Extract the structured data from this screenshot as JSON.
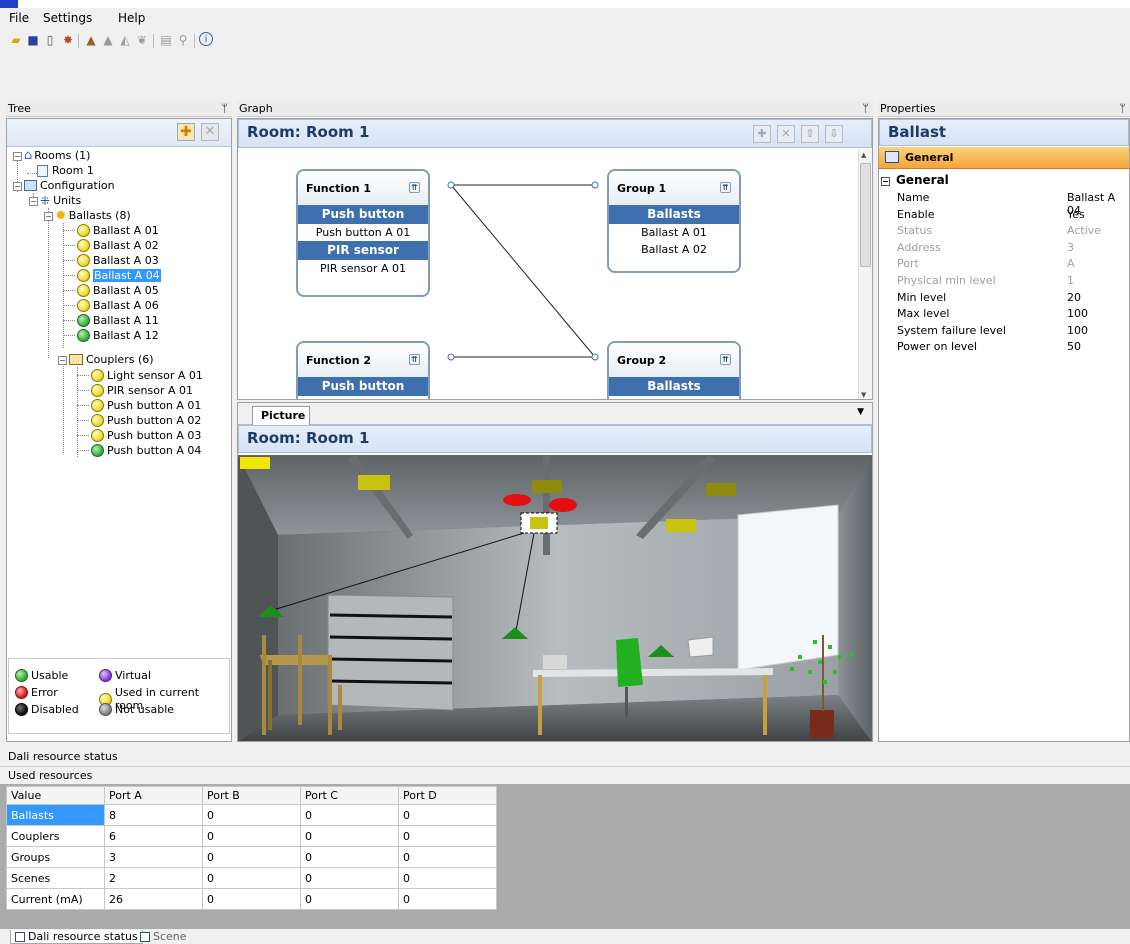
{
  "menu": {
    "items": [
      "File",
      "Settings",
      "Help"
    ]
  },
  "toolbar": {
    "icons": [
      "open-icon",
      "save-icon",
      "new-icon",
      "import-icon",
      "add-ballast-icon",
      "add-coupler-icon",
      "add-unit-icon",
      "connect-icon",
      "report-icon",
      "search-icon",
      "info-icon"
    ]
  },
  "tree_panel": {
    "title": "Tree",
    "pin": "ᛘ"
  },
  "graph_panel": {
    "title": "Graph",
    "pin": "ᛘ",
    "header": "Room: Room 1"
  },
  "properties_panel": {
    "title": "Properties",
    "pin": "ᛘ",
    "header": "Ballast",
    "tab": "General",
    "section": "General",
    "rows": [
      {
        "k": "Name",
        "v": "Ballast A 04",
        "dim": false
      },
      {
        "k": "Enable",
        "v": "Yes",
        "dim": false
      },
      {
        "k": "Status",
        "v": "Active",
        "dim": true
      },
      {
        "k": "Address",
        "v": "3",
        "dim": true
      },
      {
        "k": "Port",
        "v": "A",
        "dim": true
      },
      {
        "k": "Physical min level",
        "v": "1",
        "dim": true
      },
      {
        "k": "Min level",
        "v": "20",
        "dim": false
      },
      {
        "k": "Max level",
        "v": "100",
        "dim": false
      },
      {
        "k": "System failure level",
        "v": "100",
        "dim": false
      },
      {
        "k": "Power on level",
        "v": "50",
        "dim": false
      }
    ]
  },
  "tree": {
    "rooms": "Rooms (1)",
    "room1": "Room 1",
    "configuration": "Configuration",
    "units": "Units",
    "ballasts": "Ballasts (8)",
    "ballast_items": [
      {
        "label": "Ballast A 01",
        "status": "yellow"
      },
      {
        "label": "Ballast A 02",
        "status": "yellow"
      },
      {
        "label": "Ballast A 03",
        "status": "yellow"
      },
      {
        "label": "Ballast A 04",
        "status": "yellow",
        "selected": true
      },
      {
        "label": "Ballast A 05",
        "status": "yellow"
      },
      {
        "label": "Ballast A 06",
        "status": "yellow"
      },
      {
        "label": "Ballast A 11",
        "status": "green"
      },
      {
        "label": "Ballast A 12",
        "status": "green"
      }
    ],
    "couplers": "Couplers (6)",
    "coupler_items": [
      {
        "label": "Light sensor A 01",
        "status": "yellow"
      },
      {
        "label": "PIR sensor A 01",
        "status": "yellow"
      },
      {
        "label": "Push button A 01",
        "status": "yellow"
      },
      {
        "label": "Push button A 02",
        "status": "yellow"
      },
      {
        "label": "Push button A 03",
        "status": "yellow"
      },
      {
        "label": "Push button A 04",
        "status": "green"
      }
    ]
  },
  "legend": {
    "usable": "Usable",
    "error": "Error",
    "disabled": "Disabled",
    "virtual": "Virtual",
    "used": "Used in current room",
    "not_usable": "Not usable"
  },
  "graph": {
    "function1": {
      "title": "Function 1",
      "bar1": "Push button",
      "item1": "Push button A 01",
      "bar2": "PIR sensor",
      "item2": "PIR sensor A 01"
    },
    "group1": {
      "title": "Group 1",
      "bar": "Ballasts",
      "item1": "Ballast A 01",
      "item2": "Ballast A 02"
    },
    "function2": {
      "title": "Function 2",
      "bar": "Push button"
    },
    "group2": {
      "title": "Group 2",
      "bar": "Ballasts"
    }
  },
  "picture": {
    "tab": "Picture",
    "header": "Room: Room 1"
  },
  "dali": {
    "title": "Dali resource status",
    "subtitle": "Used resources",
    "columns": [
      "Value",
      "Port A",
      "Port B",
      "Port C",
      "Port D"
    ],
    "rows": [
      [
        "Ballasts",
        "8",
        "0",
        "0",
        "0"
      ],
      [
        "Couplers",
        "6",
        "0",
        "0",
        "0"
      ],
      [
        "Groups",
        "3",
        "0",
        "0",
        "0"
      ],
      [
        "Scenes",
        "2",
        "0",
        "0",
        "0"
      ],
      [
        "Current (mA)",
        "26",
        "0",
        "0",
        "0"
      ]
    ]
  },
  "bottom_tabs": [
    "Dali resource status",
    "Scene"
  ],
  "colors": {
    "accent": "#3399ff",
    "header_blue": "#1b3b6b",
    "bar_blue": "#3e6fae",
    "orange_tab": "#f5a43a"
  }
}
